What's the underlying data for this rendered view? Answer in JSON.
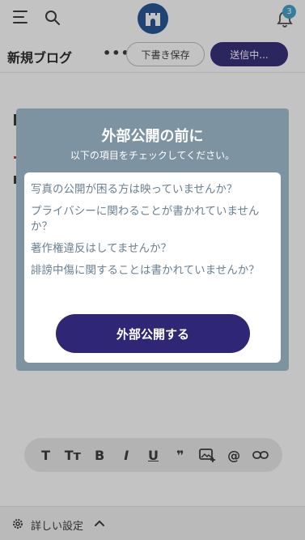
{
  "header": {
    "menu_icon": "hamburger-icon",
    "search_icon": "search-icon",
    "logo_icon": "castle-logo",
    "bell_icon": "bell-icon",
    "notification_count": "3"
  },
  "titlebar": {
    "title": "新規ブログ",
    "more_label": "•••",
    "draft_label": "下書き保存",
    "send_label": "送信中..."
  },
  "toolbar": {
    "tools": [
      {
        "icon": "text-icon",
        "glyph": "T"
      },
      {
        "icon": "text-size-icon",
        "glyph": "Tт"
      },
      {
        "icon": "bold-icon",
        "glyph": "B"
      },
      {
        "icon": "italic-icon",
        "glyph": "I"
      },
      {
        "icon": "underline-icon",
        "glyph": "U"
      },
      {
        "icon": "quote-icon",
        "glyph": "❞"
      },
      {
        "icon": "image-add-icon",
        "glyph": ""
      },
      {
        "icon": "mention-icon",
        "glyph": "@"
      },
      {
        "icon": "link-icon",
        "glyph": ""
      }
    ]
  },
  "settings": {
    "label": "詳しい設定"
  },
  "modal": {
    "title": "外部公開の前に",
    "subtitle": "以下の項目をチェックしてください。",
    "items": [
      "写真の公開が困る方は映っていませんか？",
      "プライバシーに関わることが書かれていませんか？",
      "著作権違反はしてませんか？",
      "誹謗中傷に関することは書かれていませんか？"
    ],
    "publish_label": "外部公開する"
  },
  "colors": {
    "primary": "#2f2675",
    "modal_bg": "#7e93a2",
    "badge": "#3a9fcb",
    "logo": "#1d4e8f",
    "item_text": "#6b8090"
  }
}
